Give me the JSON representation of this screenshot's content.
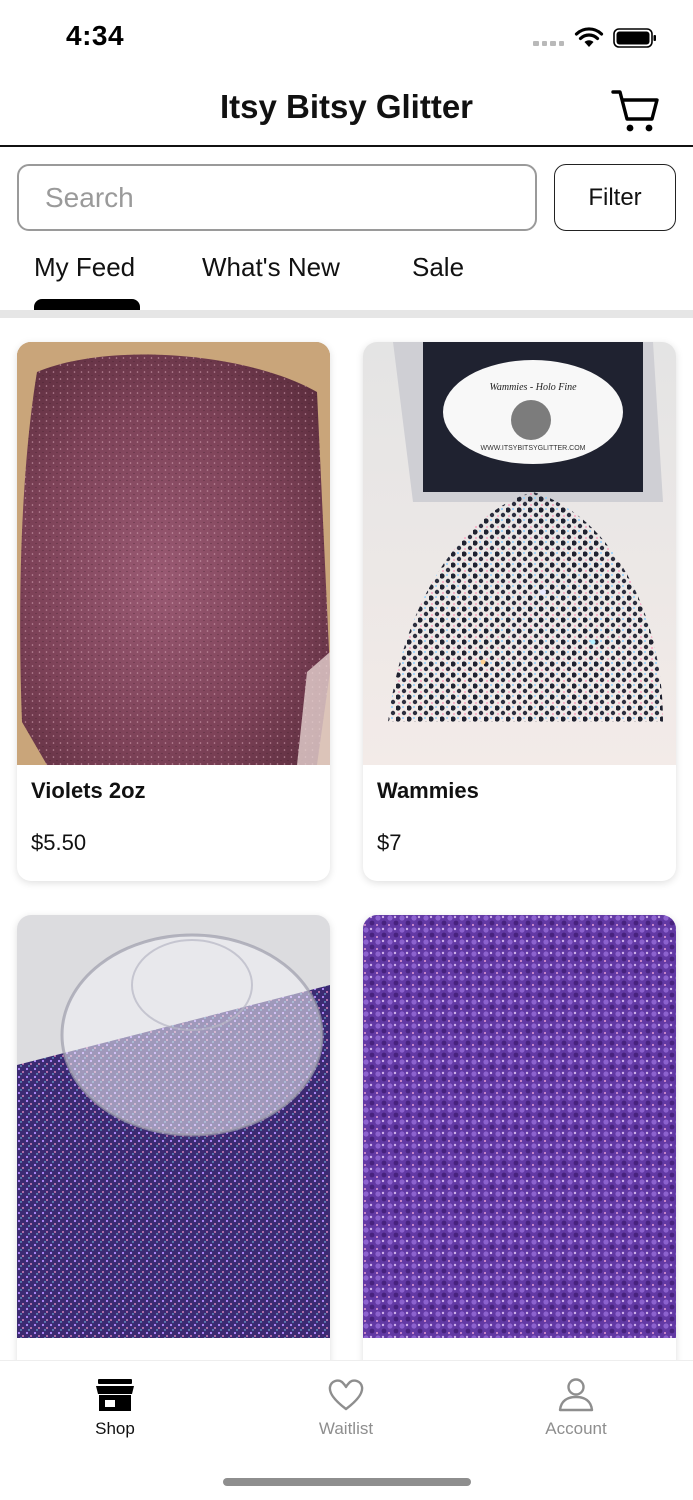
{
  "status_bar": {
    "time": "4:34"
  },
  "header": {
    "title": "Itsy Bitsy Glitter"
  },
  "search": {
    "placeholder": "Search",
    "value": "",
    "filter_label": "Filter"
  },
  "tabs": [
    {
      "label": "My Feed",
      "active": true
    },
    {
      "label": "What's New",
      "active": false
    },
    {
      "label": "Sale",
      "active": false
    }
  ],
  "products": [
    {
      "name": "Violets 2oz",
      "price": "$5.50",
      "image": "pink-violet-fine-glitter"
    },
    {
      "name": "Wammies",
      "price": "$7",
      "image": "black-holo-chunky-glitter-bag",
      "bag_label": "Wammies - Holo Fine",
      "bag_url": "WWW.ITSYBITSYGLITTER.COM"
    },
    {
      "name": "",
      "price": "",
      "image": "purple-holo-glitter-cup"
    },
    {
      "name": "",
      "price": "",
      "image": "lilac-holo-chunky-glitter"
    }
  ],
  "bottom_nav": [
    {
      "label": "Shop",
      "icon": "storefront-icon",
      "active": true
    },
    {
      "label": "Waitlist",
      "icon": "heart-icon",
      "active": false
    },
    {
      "label": "Account",
      "icon": "person-icon",
      "active": false
    }
  ],
  "colors": {
    "text": "#111111",
    "inactive_nav": "#8e8e8e",
    "divider": "#e6e6e6",
    "input_border": "#9a9a9a"
  }
}
